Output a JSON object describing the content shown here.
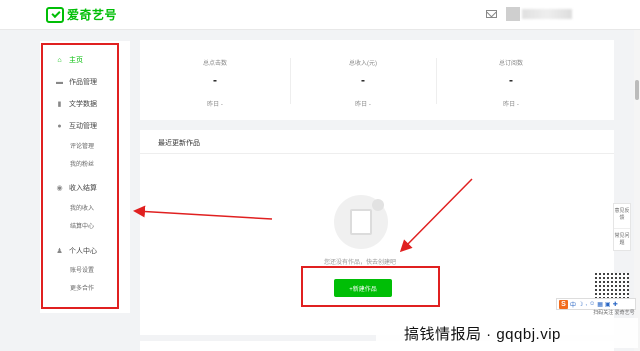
{
  "header": {
    "logo_text": "爱奇艺号"
  },
  "sidebar": {
    "items": [
      {
        "label": "主页",
        "icon": "home-icon",
        "active": true
      },
      {
        "label": "作品管理",
        "icon": "folder-icon"
      },
      {
        "label": "文学数据",
        "icon": "chart-icon"
      },
      {
        "label": "互动管理",
        "icon": "chat-icon"
      },
      {
        "label": "评论管理",
        "sub": true
      },
      {
        "label": "我的粉丝",
        "sub": true
      },
      {
        "label": "收入结算",
        "icon": "coin-icon"
      },
      {
        "label": "我的收入",
        "sub": true
      },
      {
        "label": "结算中心",
        "sub": true
      },
      {
        "label": "个人中心",
        "icon": "user-icon"
      },
      {
        "label": "账号设置",
        "sub": true
      },
      {
        "label": "更多合作",
        "sub": true
      }
    ]
  },
  "stats": [
    {
      "label": "总点击数",
      "value": "-",
      "sub": "昨日 -"
    },
    {
      "label": "总收入(元)",
      "value": "-",
      "sub": "昨日 -"
    },
    {
      "label": "总订阅数",
      "value": "-",
      "sub": "昨日 -"
    }
  ],
  "recent": {
    "title": "最近更新作品",
    "empty_text": "您还没有作品，快去创建吧",
    "new_button": "+新建作品"
  },
  "float": {
    "feedback": "意见反馈",
    "faq": "常见问题",
    "qr_text": "扫码关注 爱奇艺号"
  },
  "ime": {
    "label": "中"
  },
  "watermark": "搞钱情报局 · gqqbj.vip",
  "colors": {
    "brand_green": "#00be06",
    "annotation_red": "#e02020"
  }
}
